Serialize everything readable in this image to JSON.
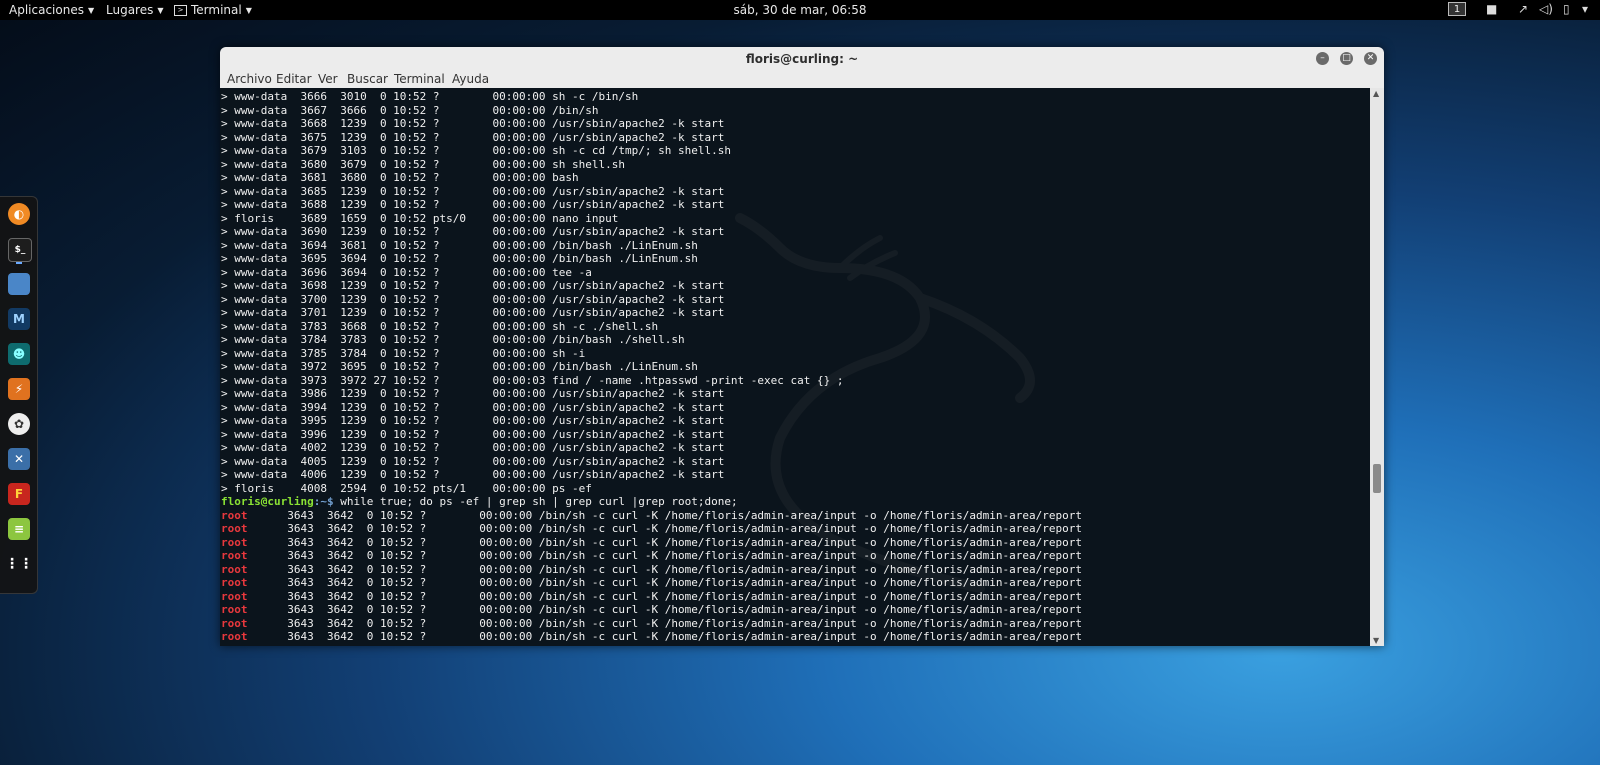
{
  "topbar": {
    "aplicaciones": "Aplicaciones",
    "lugares": "Lugares",
    "terminal": "Terminal",
    "clock": "sáb, 30 de mar, 06:58",
    "workspace": "1"
  },
  "window": {
    "title": "floris@curling: ~",
    "menu": [
      "Archivo",
      "Editar",
      "Ver",
      "Buscar",
      "Terminal",
      "Ayuda"
    ]
  },
  "scroll": {
    "position": 0.72,
    "thumb_fraction": 0.055
  },
  "terminal": {
    "ps_lines": [
      "> www-data  3666  3010  0 10:52 ?        00:00:00 sh -c /bin/sh",
      "> www-data  3667  3666  0 10:52 ?        00:00:00 /bin/sh",
      "> www-data  3668  1239  0 10:52 ?        00:00:00 /usr/sbin/apache2 -k start",
      "> www-data  3675  1239  0 10:52 ?        00:00:00 /usr/sbin/apache2 -k start",
      "> www-data  3679  3103  0 10:52 ?        00:00:00 sh -c cd /tmp/; sh shell.sh",
      "> www-data  3680  3679  0 10:52 ?        00:00:00 sh shell.sh",
      "> www-data  3681  3680  0 10:52 ?        00:00:00 bash",
      "> www-data  3685  1239  0 10:52 ?        00:00:00 /usr/sbin/apache2 -k start",
      "> www-data  3688  1239  0 10:52 ?        00:00:00 /usr/sbin/apache2 -k start",
      "> floris    3689  1659  0 10:52 pts/0    00:00:00 nano input",
      "> www-data  3690  1239  0 10:52 ?        00:00:00 /usr/sbin/apache2 -k start",
      "> www-data  3694  3681  0 10:52 ?        00:00:00 /bin/bash ./LinEnum.sh",
      "> www-data  3695  3694  0 10:52 ?        00:00:00 /bin/bash ./LinEnum.sh",
      "> www-data  3696  3694  0 10:52 ?        00:00:00 tee -a",
      "> www-data  3698  1239  0 10:52 ?        00:00:00 /usr/sbin/apache2 -k start",
      "> www-data  3700  1239  0 10:52 ?        00:00:00 /usr/sbin/apache2 -k start",
      "> www-data  3701  1239  0 10:52 ?        00:00:00 /usr/sbin/apache2 -k start",
      "> www-data  3783  3668  0 10:52 ?        00:00:00 sh -c ./shell.sh",
      "> www-data  3784  3783  0 10:52 ?        00:00:00 /bin/bash ./shell.sh",
      "> www-data  3785  3784  0 10:52 ?        00:00:00 sh -i",
      "> www-data  3972  3695  0 10:52 ?        00:00:00 /bin/bash ./LinEnum.sh",
      "> www-data  3973  3972 27 10:52 ?        00:00:03 find / -name .htpasswd -print -exec cat {} ;",
      "> www-data  3986  1239  0 10:52 ?        00:00:00 /usr/sbin/apache2 -k start",
      "> www-data  3994  1239  0 10:52 ?        00:00:00 /usr/sbin/apache2 -k start",
      "> www-data  3995  1239  0 10:52 ?        00:00:00 /usr/sbin/apache2 -k start",
      "> www-data  3996  1239  0 10:52 ?        00:00:00 /usr/sbin/apache2 -k start",
      "> www-data  4002  1239  0 10:52 ?        00:00:00 /usr/sbin/apache2 -k start",
      "> www-data  4005  1239  0 10:52 ?        00:00:00 /usr/sbin/apache2 -k start",
      "> www-data  4006  1239  0 10:52 ?        00:00:00 /usr/sbin/apache2 -k start",
      "> floris    4008  2594  0 10:52 pts/1    00:00:00 ps -ef"
    ],
    "prompt_user": "floris@curling",
    "prompt_path": ":~$",
    "prompt_command": " while true; do ps -ef | grep sh | grep curl |grep root;done;",
    "root_user": "root",
    "root_rest": "      3643  3642  0 10:52 ?        00:00:00 /bin/sh -c curl -K /home/floris/admin-area/input -o /home/floris/admin-area/report",
    "root_line_count": 10
  },
  "colors": {
    "root": "#e8383d",
    "prompt_user": "#8ae234",
    "prompt_path": "#729fcf"
  },
  "icons": [
    "firefox-icon",
    "terminal-icon",
    "files-icon",
    "metasploit-icon",
    "armitage-icon",
    "burpsuite-icon",
    "maltego-icon",
    "beef-icon",
    "faraday-icon",
    "leafpad-icon",
    "show-apps-icon"
  ]
}
